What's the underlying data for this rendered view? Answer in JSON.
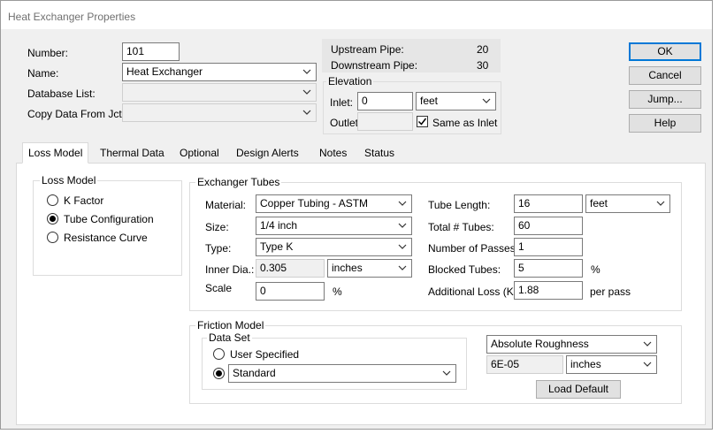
{
  "window": {
    "title": "Heat Exchanger Properties"
  },
  "header": {
    "number_label": "Number:",
    "number_value": "101",
    "name_label": "Name:",
    "name_value": "Heat Exchanger",
    "database_label": "Database List:",
    "database_value": "",
    "copy_label": "Copy Data From Jct...",
    "copy_value": ""
  },
  "pipes": {
    "upstream_label": "Upstream Pipe:",
    "upstream_value": "20",
    "downstream_label": "Downstream Pipe:",
    "downstream_value": "30"
  },
  "elevation": {
    "title": "Elevation",
    "inlet_label": "Inlet:",
    "inlet_value": "0",
    "unit": "feet",
    "outlet_label": "Outlet:",
    "outlet_value": "",
    "same_as_inlet_label": "Same as Inlet",
    "same_as_inlet_checked": true
  },
  "buttons": {
    "ok": "OK",
    "cancel": "Cancel",
    "jump": "Jump...",
    "help": "Help"
  },
  "tabs": [
    {
      "label": "Loss Model",
      "active": true
    },
    {
      "label": "Thermal Data"
    },
    {
      "label": "Optional"
    },
    {
      "label": "Design Alerts"
    },
    {
      "label": "Notes"
    },
    {
      "label": "Status"
    }
  ],
  "loss_model": {
    "title": "Loss Model",
    "options": [
      "K Factor",
      "Tube Configuration",
      "Resistance Curve"
    ],
    "selected": "Tube Configuration"
  },
  "exchanger_tubes": {
    "title": "Exchanger Tubes",
    "material_label": "Material:",
    "material_value": "Copper Tubing - ASTM",
    "size_label": "Size:",
    "size_value": "1/4 inch",
    "type_label": "Type:",
    "type_value": "Type K",
    "inner_dia_label": "Inner Dia.:",
    "inner_dia_value": "0.305",
    "inner_dia_unit": "inches",
    "scale_label": "Scale",
    "scale_value": "0",
    "scale_unit": "%",
    "tube_length_label": "Tube Length:",
    "tube_length_value": "16",
    "tube_length_unit": "feet",
    "total_tubes_label": "Total # Tubes:",
    "total_tubes_value": "60",
    "passes_label": "Number of Passes:",
    "passes_value": "1",
    "blocked_label": "Blocked Tubes:",
    "blocked_value": "5",
    "blocked_unit": "%",
    "additional_loss_label": "Additional Loss (K):",
    "additional_loss_value": "1.88",
    "additional_loss_unit": "per pass"
  },
  "friction_model": {
    "title": "Friction Model",
    "data_set_title": "Data Set",
    "user_specified_label": "User Specified",
    "standard_label": "Standard",
    "standard_value": "Standard",
    "roughness_type": "Absolute Roughness",
    "roughness_value": "6E-05",
    "roughness_unit": "inches",
    "load_default": "Load Default"
  },
  "colors": {
    "accent": "#0078d7",
    "panel": "#ffffff",
    "dialog": "#f0f0f0"
  }
}
